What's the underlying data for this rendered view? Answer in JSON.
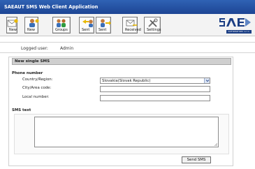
{
  "app": {
    "title": "SAEAUT SMS Web Client Application"
  },
  "toolbar": {
    "buttons": [
      {
        "label": "New",
        "icon": "new-sms-icon"
      },
      {
        "label": "New",
        "icon": "new-contact-icon"
      },
      {
        "label": "Groups",
        "icon": "groups-icon"
      },
      {
        "label": "Sent",
        "icon": "sent-icon"
      },
      {
        "label": "Sent",
        "icon": "sent-folder-icon"
      },
      {
        "label": "Received",
        "icon": "received-icon"
      },
      {
        "label": "Settings",
        "icon": "settings-icon"
      }
    ]
  },
  "logo": {
    "text": "SAE",
    "tagline": "AUTOMATION, s.r.o."
  },
  "user": {
    "label": "Logged user:",
    "name": "Admin"
  },
  "form": {
    "header": "New single SMS",
    "phone_section": "Phone number",
    "country_label": "Country/Region:",
    "country_value": "Slovakia(Slovak Republic)",
    "area_label": "City/Area code:",
    "area_value": "",
    "local_label": "Local number:",
    "local_value": "",
    "sms_section": "SMS text",
    "sms_value": "",
    "send_label": "Send SMS"
  },
  "colors": {
    "title_bar": "#2f62b4",
    "panel_header": "#cfcfcf",
    "logo_blue": "#1b3e84"
  }
}
